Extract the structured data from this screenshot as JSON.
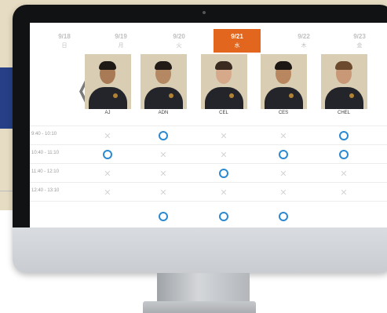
{
  "dates": [
    {
      "date": "9/18",
      "weekday": "日",
      "active": false
    },
    {
      "date": "9/19",
      "weekday": "月",
      "active": false
    },
    {
      "date": "9/20",
      "weekday": "火",
      "active": false
    },
    {
      "date": "9/21",
      "weekday": "水",
      "active": true
    },
    {
      "date": "9/22",
      "weekday": "木",
      "active": false
    },
    {
      "date": "9/23",
      "weekday": "金",
      "active": false
    }
  ],
  "nav": {
    "prev_arrow": "❬"
  },
  "teachers": [
    {
      "name": "AJ",
      "skin": "#a87a55",
      "hair": "#1e1915"
    },
    {
      "name": "ADN",
      "skin": "#b58864",
      "hair": "#221b16"
    },
    {
      "name": "CEL",
      "skin": "#d6a98a",
      "hair": "#3a2a20"
    },
    {
      "name": "CES",
      "skin": "#b9875f",
      "hair": "#1d1713"
    },
    {
      "name": "CHEL",
      "skin": "#c99977",
      "hair": "#6b4a2e"
    }
  ],
  "time_slots": [
    {
      "label": "9:40 - 10:10",
      "marks": [
        "x",
        "o",
        "x",
        "x",
        "o"
      ]
    },
    {
      "label": "10:40 - 11:10",
      "marks": [
        "o",
        "x",
        "x",
        "o",
        "o"
      ]
    },
    {
      "label": "11:40 - 12:10",
      "marks": [
        "x",
        "x",
        "o",
        "x",
        "x"
      ]
    },
    {
      "label": "12:40 - 13:10",
      "marks": [
        "x",
        "x",
        "x",
        "x",
        "x"
      ]
    },
    {
      "label": "",
      "marks": [
        "",
        "o",
        "o",
        "o",
        ""
      ]
    }
  ],
  "colors": {
    "accent": "#e2661d",
    "mark_available": "#2b89d2",
    "mark_unavailable": "#d4d4d4"
  }
}
